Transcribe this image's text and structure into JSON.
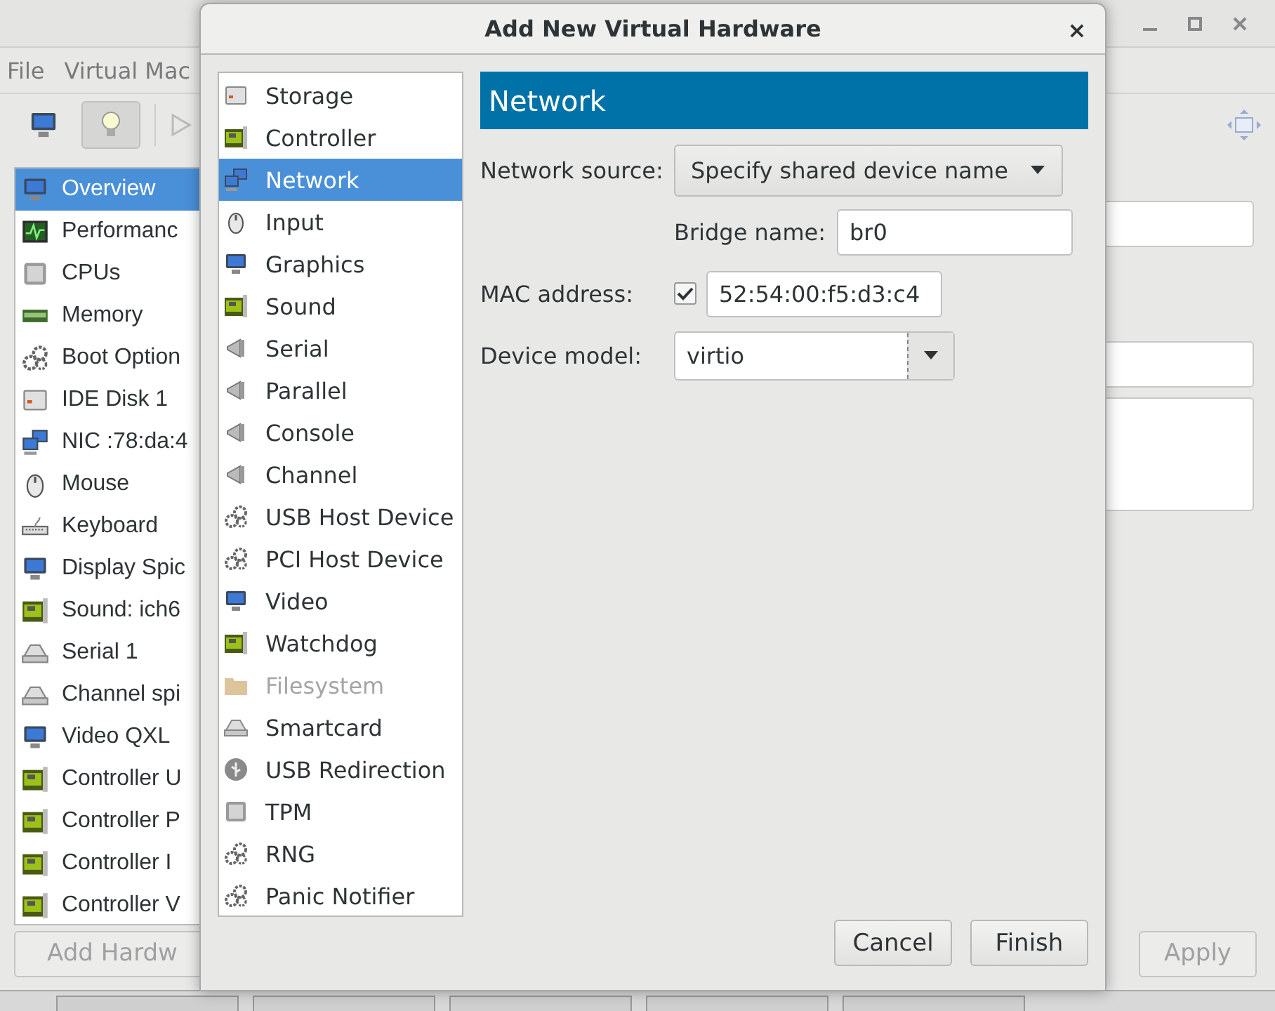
{
  "background_window": {
    "menu": [
      "File",
      "Virtual Mac"
    ],
    "devices": [
      {
        "label": "Overview",
        "kind": "monitor",
        "selected": true
      },
      {
        "label": "Performanc",
        "kind": "chart",
        "selected": false
      },
      {
        "label": "CPUs",
        "kind": "chip",
        "selected": false
      },
      {
        "label": "Memory",
        "kind": "memory",
        "selected": false
      },
      {
        "label": "Boot Option",
        "kind": "gears",
        "selected": false
      },
      {
        "label": "IDE Disk 1",
        "kind": "disk",
        "selected": false
      },
      {
        "label": "NIC :78:da:4",
        "kind": "network",
        "selected": false
      },
      {
        "label": "Mouse",
        "kind": "mouse",
        "selected": false
      },
      {
        "label": "Keyboard",
        "kind": "keyboard",
        "selected": false
      },
      {
        "label": "Display Spic",
        "kind": "monitor",
        "selected": false
      },
      {
        "label": "Sound: ich6",
        "kind": "card",
        "selected": false
      },
      {
        "label": "Serial 1",
        "kind": "scanner",
        "selected": false
      },
      {
        "label": "Channel spi",
        "kind": "scanner",
        "selected": false
      },
      {
        "label": "Video QXL",
        "kind": "monitor",
        "selected": false
      },
      {
        "label": "Controller U",
        "kind": "card",
        "selected": false
      },
      {
        "label": "Controller P",
        "kind": "card",
        "selected": false
      },
      {
        "label": "Controller I",
        "kind": "card",
        "selected": false
      },
      {
        "label": "Controller V",
        "kind": "card",
        "selected": false
      }
    ],
    "add_button": {
      "label": "Add Hardw",
      "disabled": true
    },
    "apply_button": {
      "label": "Apply",
      "disabled": true
    }
  },
  "dialog": {
    "title": "Add New Virtual Hardware",
    "close": "×",
    "categories": [
      {
        "label": "Storage",
        "kind": "disk",
        "selected": false,
        "disabled": false
      },
      {
        "label": "Controller",
        "kind": "card",
        "selected": false,
        "disabled": false
      },
      {
        "label": "Network",
        "kind": "network",
        "selected": true,
        "disabled": false
      },
      {
        "label": "Input",
        "kind": "mouse",
        "selected": false,
        "disabled": false
      },
      {
        "label": "Graphics",
        "kind": "monitor",
        "selected": false,
        "disabled": false
      },
      {
        "label": "Sound",
        "kind": "card",
        "selected": false,
        "disabled": false
      },
      {
        "label": "Serial",
        "kind": "connector",
        "selected": false,
        "disabled": false
      },
      {
        "label": "Parallel",
        "kind": "connector",
        "selected": false,
        "disabled": false
      },
      {
        "label": "Console",
        "kind": "connector",
        "selected": false,
        "disabled": false
      },
      {
        "label": "Channel",
        "kind": "connector",
        "selected": false,
        "disabled": false
      },
      {
        "label": "USB Host Device",
        "kind": "gears",
        "selected": false,
        "disabled": false
      },
      {
        "label": "PCI Host Device",
        "kind": "gears",
        "selected": false,
        "disabled": false
      },
      {
        "label": "Video",
        "kind": "monitor",
        "selected": false,
        "disabled": false
      },
      {
        "label": "Watchdog",
        "kind": "card",
        "selected": false,
        "disabled": false
      },
      {
        "label": "Filesystem",
        "kind": "folder",
        "selected": false,
        "disabled": true
      },
      {
        "label": "Smartcard",
        "kind": "scanner",
        "selected": false,
        "disabled": false
      },
      {
        "label": "USB Redirection",
        "kind": "usb",
        "selected": false,
        "disabled": false
      },
      {
        "label": "TPM",
        "kind": "chip",
        "selected": false,
        "disabled": false
      },
      {
        "label": "RNG",
        "kind": "gears",
        "selected": false,
        "disabled": false
      },
      {
        "label": "Panic Notifier",
        "kind": "gears",
        "selected": false,
        "disabled": false
      }
    ],
    "section_title": "Network",
    "network_source": {
      "label": "Network source:",
      "value": "Specify shared device name"
    },
    "bridge_name": {
      "label": "Bridge name:",
      "value": "br0"
    },
    "mac_address": {
      "label": "MAC address:",
      "checked": true,
      "value": "52:54:00:f5:d3:c4"
    },
    "device_model": {
      "label": "Device model:",
      "value": "virtio"
    },
    "buttons": [
      "Cancel",
      "Finish"
    ]
  }
}
